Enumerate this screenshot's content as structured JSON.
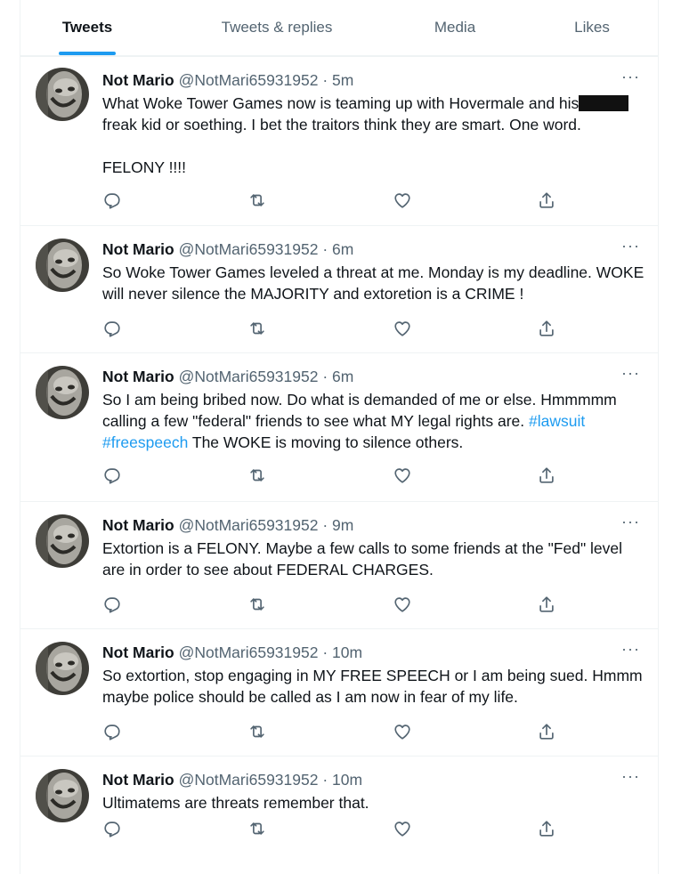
{
  "colors": {
    "accent": "#1d9bf0",
    "text": "#0f1419",
    "muted": "#536471",
    "border": "#eff3f4"
  },
  "tabs": [
    {
      "label": "Tweets",
      "active": true
    },
    {
      "label": "Tweets & replies",
      "active": false
    },
    {
      "label": "Media",
      "active": false
    },
    {
      "label": "Likes",
      "active": false
    }
  ],
  "tweets": [
    {
      "name": "Not Mario",
      "handle": "@NotMari65931952",
      "time": "· 5m",
      "text_a": "What Woke Tower Games now is teaming up with Hovermale and his",
      "text_b": "freak kid or soething. I bet the traitors think they are smart. One word.\n\nFELONY !!!!"
    },
    {
      "name": "Not Mario",
      "handle": "@NotMari65931952",
      "time": "· 6m",
      "text": "So Woke Tower Games leveled a threat at me. Monday is my deadline. WOKE will never silence the MAJORITY and extoretion is a CRIME !"
    },
    {
      "name": "Not Mario",
      "handle": "@NotMari65931952",
      "time": "· 6m",
      "text_a": "So I am being bribed now. Do what is demanded of me or else. Hmmmmm calling a few \"federal\" friends to see what MY legal rights are.",
      "hashtag1": "#lawsuit",
      "hashtag2": "#freespeech",
      "text_b": "The WOKE is moving to silence others."
    },
    {
      "name": "Not Mario",
      "handle": "@NotMari65931952",
      "time": "· 9m",
      "text": "Extortion is a FELONY. Maybe a few calls to some friends at the \"Fed\" level are in order to see about FEDERAL CHARGES."
    },
    {
      "name": "Not Mario",
      "handle": "@NotMari65931952",
      "time": "· 10m",
      "text": "So extortion, stop engaging in MY FREE SPEECH or I am being sued. Hmmm maybe police should be called as I am now in fear of my life."
    },
    {
      "name": "Not Mario",
      "handle": "@NotMari65931952",
      "time": "· 10m",
      "text": "Ultimatems are threats remember that."
    }
  ],
  "icons": {
    "more": "more-dots-icon",
    "reply": "reply-icon",
    "retweet": "retweet-icon",
    "like": "heart-icon",
    "share": "share-icon"
  }
}
